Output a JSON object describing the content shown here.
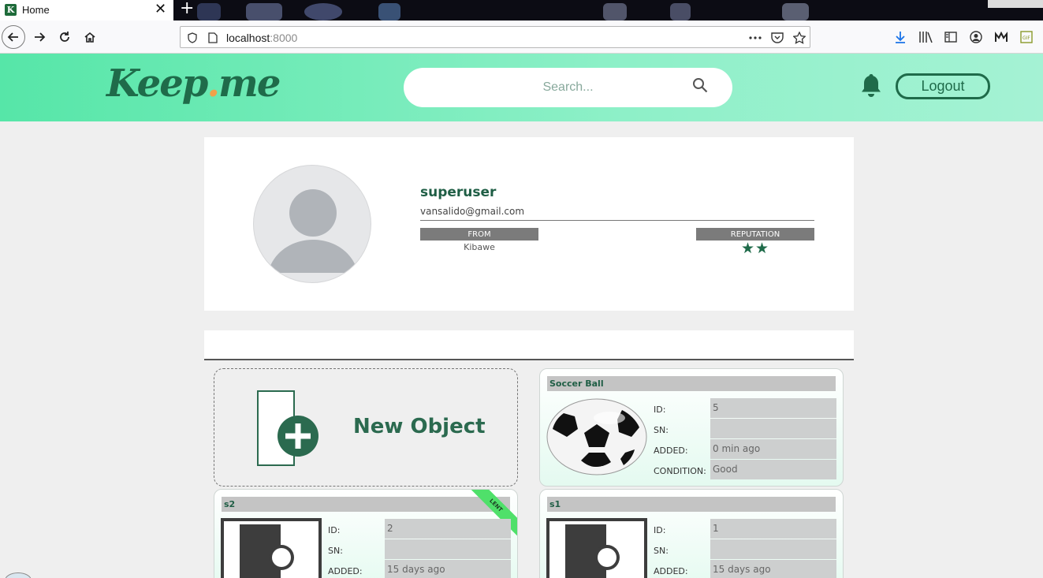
{
  "browser": {
    "tab_title": "Home",
    "tab_favicon_letter": "K",
    "close_glyph": "✕",
    "new_tab_glyph": "+",
    "url_host": "localhost",
    "url_port": ":8000"
  },
  "header": {
    "logo_main": "Keep",
    "logo_dot": ".",
    "logo_tail": "me",
    "search_placeholder": "Search...",
    "logout_label": "Logout",
    "accent_color": "#1f6b4a"
  },
  "profile": {
    "username": "superuser",
    "email": "vansalido@gmail.com",
    "from_label": "FROM",
    "from_value": "Kibawe",
    "reputation_label": "REPUTATION",
    "reputation_stars": "★★",
    "reputation_rating": 2
  },
  "objects": {
    "new_object_label": "New Object",
    "field_labels": {
      "id": "ID:",
      "sn": "SN:",
      "added": "ADDED:",
      "condition": "CONDITION:"
    },
    "items": [
      {
        "name": "Soccer Ball",
        "id": "5",
        "sn": "",
        "added": "0 min ago",
        "condition": "Good",
        "image": "soccer-ball-icon"
      },
      {
        "name": "s2",
        "id": "2",
        "sn": "",
        "added": "15 days ago",
        "badge": "LENT",
        "image": "door-placeholder-icon"
      },
      {
        "name": "s1",
        "id": "1",
        "sn": "",
        "added": "15 days ago",
        "image": "door-placeholder-icon"
      }
    ]
  }
}
